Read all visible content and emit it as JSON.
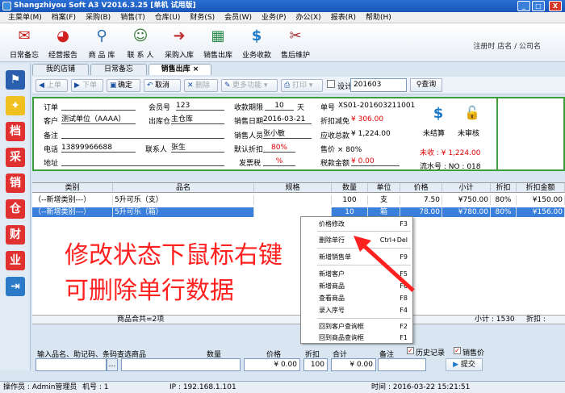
{
  "window": {
    "title": "Shangzhiyou Soft A3 V2016.3.25 [单机 试用版]",
    "minimize": "_",
    "maximize": "□",
    "close": "X"
  },
  "menu": [
    "主菜单(M)",
    "档案(F)",
    "采购(B)",
    "销售(T)",
    "仓库(U)",
    "财务(S)",
    "会员(W)",
    "业务(P)",
    "办公(X)",
    "报表(R)",
    "帮助(H)"
  ],
  "toolbar": {
    "buttons": [
      {
        "label": "日常备忘",
        "icon": "memo-icon"
      },
      {
        "label": "经营报告",
        "icon": "report-icon"
      },
      {
        "label": "商 品 库",
        "icon": "magnifier-icon"
      },
      {
        "label": "联 系 人",
        "icon": "contacts-icon"
      },
      {
        "label": "采购入库",
        "icon": "purchase-icon"
      },
      {
        "label": "销售出库",
        "icon": "sales-out-icon"
      },
      {
        "label": "业务收款",
        "icon": "dollar-icon"
      },
      {
        "label": "售后维护",
        "icon": "tools-icon"
      }
    ],
    "registration": "注册时 店名 / 公司名"
  },
  "tabs": [
    "我的店铺",
    "日常备忘",
    "销售出库"
  ],
  "sidebar": [
    "档",
    "采",
    "销",
    "仓",
    "财",
    "业"
  ],
  "subtoolbar": {
    "prev": "上单",
    "next": "下单",
    "confirm": "确定",
    "cancel": "取消",
    "delete": "删除",
    "more": "更多功能",
    "print": "打印",
    "design": "设计",
    "doc_search": "201603",
    "query": "查询"
  },
  "form": {
    "order_label": "订单",
    "order_value": "",
    "member_label": "会员号",
    "member_value": "123",
    "credit_days_label": "收款期限",
    "credit_days_value": "10",
    "credit_days_unit": "天",
    "doc_no_label": "单号",
    "doc_no_value": "XS01-201603211001",
    "customer_label": "客户",
    "customer_value": "测试单位（AAAA）",
    "warehouse_label": "出库仓",
    "warehouse_value": "主仓库",
    "sale_date_label": "销售日期",
    "sale_date_value": "2016-03-21",
    "discount_label": "折扣减免",
    "discount_value": "¥ 306.00",
    "remark_label": "备注",
    "remark_value": "",
    "salesperson_label": "销售人员",
    "salesperson_value": "张小敏",
    "receivable_label": "应收总款",
    "receivable_value": "¥ 1,224.00",
    "phone_label": "电话",
    "phone_value": "13899966688",
    "contact_label": "联系人",
    "contact_value": "张生",
    "default_discount_label": "默认折扣",
    "default_discount_value": "80%",
    "price_rate_label": "售价 × 80%",
    "address_label": "地址",
    "address_value": "",
    "invoice_tax_label": "发票税",
    "invoice_tax_value": "%",
    "tax_total_label": "税款金额",
    "tax_total_value": "¥ 0.00"
  },
  "status_panel": {
    "unsettled": "未结算",
    "unreviewed": "未审核",
    "owed": "未收 : ¥ 1,224.00",
    "serial": "流水号 : NO : 018"
  },
  "grid": {
    "headers": [
      "类别",
      "品名",
      "规格",
      "数量",
      "单位",
      "价格",
      "小计",
      "折扣",
      "折扣金额"
    ],
    "rows": [
      [
        "（--新增类别---）",
        "5升可乐（支）",
        "",
        "100",
        "支",
        "7.50",
        "¥750.00",
        "80%",
        "¥150.00"
      ],
      [
        "（--新增类别---）",
        "5升可乐（箱）",
        "",
        "10",
        "箱",
        "78.00",
        "¥780.00",
        "80%",
        "¥156.00"
      ]
    ],
    "summary_count": "商品合共=2项",
    "summary_subtotal": "小计 : 1530",
    "summary_discount": "折扣 :"
  },
  "annotation": [
    "修改状态下鼠标右键",
    "可删除单行数据"
  ],
  "context_menu": [
    {
      "label": "价格修改",
      "key": "F3"
    },
    {
      "label": "删除单行",
      "key": "Ctrl+Del"
    },
    {
      "label": "新增销售单",
      "key": "F9"
    },
    {
      "label": "新增客户",
      "key": "F5"
    },
    {
      "label": "新增商品",
      "key": "F6"
    },
    {
      "label": "查看商品",
      "key": "F8"
    },
    {
      "label": "录入序号",
      "key": "F4"
    },
    {
      "label": "回到客户查询框",
      "key": "F2"
    },
    {
      "label": "回到商品查询框",
      "key": "F1"
    }
  ],
  "entry": {
    "item_label": "输入品名、助记码、条码查选商品",
    "qty_label": "数量",
    "price_label": "价格",
    "discount_label": "折扣",
    "total_label": "合计",
    "remark_label": "备注",
    "price_value": "¥ 0.00",
    "discount_value": "100",
    "total_value": "¥ 0.00",
    "history_label": "历史记录",
    "sale_price_label": "销售价",
    "find_button": "提交"
  },
  "statusbar": {
    "operator": "操作员 : Admin管理员",
    "machine": "机号 : 1",
    "ip": "IP : 192.168.1.101",
    "time": "时间 : 2016-03-22  15:21:51"
  },
  "colors": {
    "title_blue": "#1a56b8",
    "frame_green": "#3aa03a",
    "selection_blue": "#3a7fd9",
    "annotation_red": "#ff2020"
  }
}
